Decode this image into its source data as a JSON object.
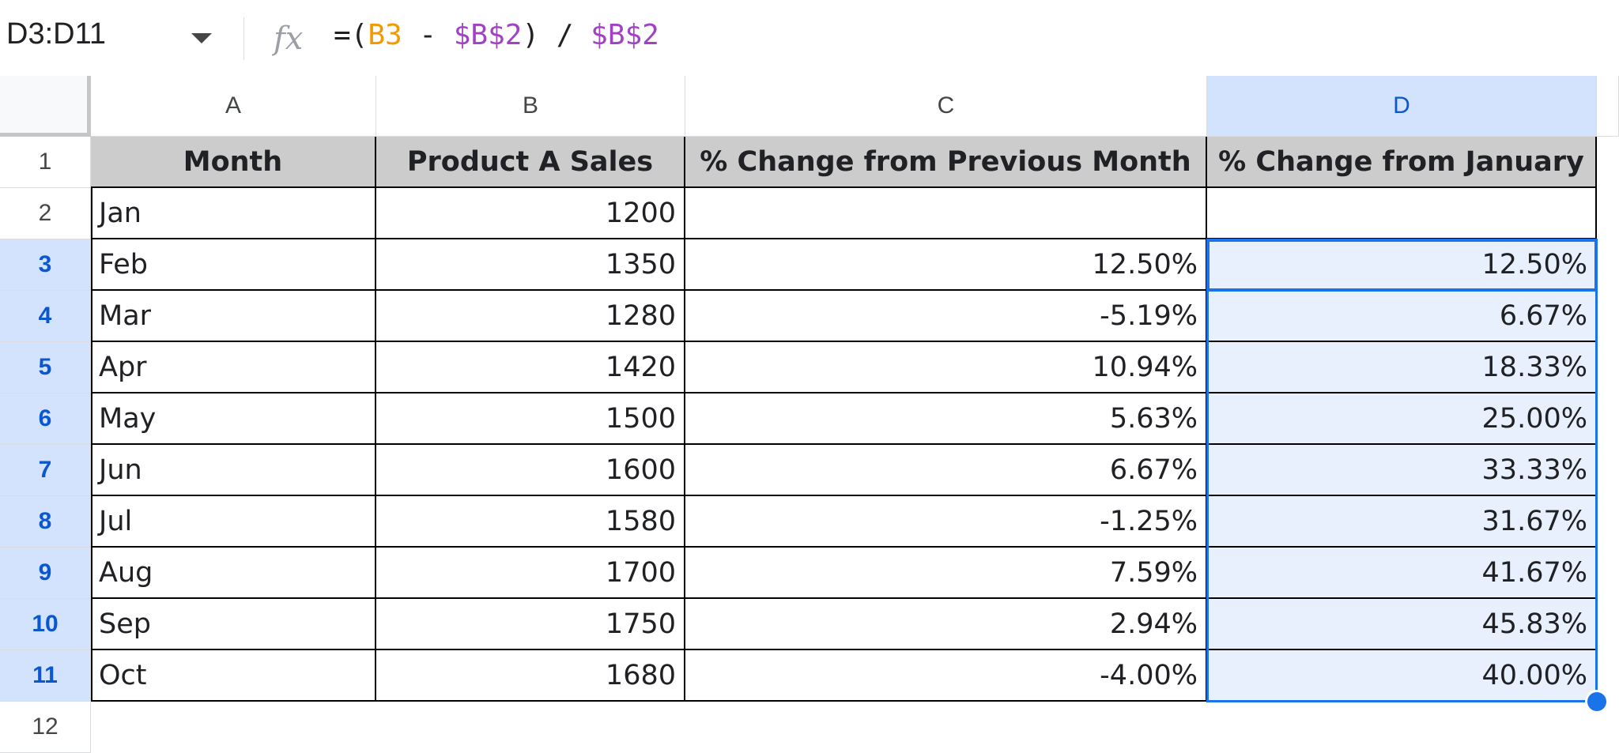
{
  "name_box": {
    "value": "D3:D11"
  },
  "formula": {
    "prefix": "=(",
    "ref1": "B3",
    "op1": " - ",
    "ref2": "$B$2",
    "op2": ") / ",
    "ref3": "$B$2"
  },
  "columns": [
    {
      "letter": "A",
      "selected": false
    },
    {
      "letter": "B",
      "selected": false
    },
    {
      "letter": "C",
      "selected": false
    },
    {
      "letter": "D",
      "selected": true
    }
  ],
  "row_numbers": [
    "1",
    "2",
    "3",
    "4",
    "5",
    "6",
    "7",
    "8",
    "9",
    "10",
    "11",
    "12"
  ],
  "selected_rows": [
    "3",
    "4",
    "5",
    "6",
    "7",
    "8",
    "9",
    "10",
    "11"
  ],
  "header_row": [
    "Month",
    "Product A Sales",
    "% Change from Previous Month",
    "% Change from January"
  ],
  "rows": [
    [
      "Jan",
      "1200",
      "",
      ""
    ],
    [
      "Feb",
      "1350",
      "12.50%",
      "12.50%"
    ],
    [
      "Mar",
      "1280",
      "-5.19%",
      "6.67%"
    ],
    [
      "Apr",
      "1420",
      "10.94%",
      "18.33%"
    ],
    [
      "May",
      "1500",
      "5.63%",
      "25.00%"
    ],
    [
      "Jun",
      "1600",
      "6.67%",
      "33.33%"
    ],
    [
      "Jul",
      "1580",
      "-1.25%",
      "31.67%"
    ],
    [
      "Aug",
      "1700",
      "7.59%",
      "41.67%"
    ],
    [
      "Sep",
      "1750",
      "2.94%",
      "45.83%"
    ],
    [
      "Oct",
      "1680",
      "-4.00%",
      "40.00%"
    ]
  ],
  "colors": {
    "selection": "#1a73e8",
    "selected_header_bg": "#d3e3fd",
    "selected_cell_bg": "#e8f0fe",
    "header_row_bg": "#cccccc",
    "formula_ref_relative": "#f29900",
    "formula_ref_absolute": "#a142c4"
  },
  "icons": {
    "fx": "function-fx-icon",
    "name_box_dropdown": "chevron-down-icon"
  }
}
